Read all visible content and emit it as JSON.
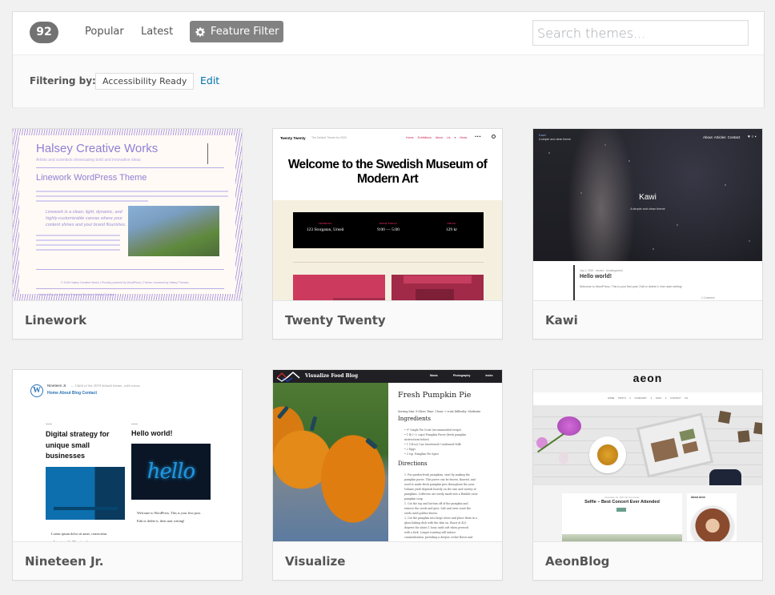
{
  "filter_bar": {
    "count": "92",
    "tabs": [
      {
        "label": "Popular"
      },
      {
        "label": "Latest"
      }
    ],
    "feature_filter": {
      "label": "Feature Filter",
      "icon": "gear-icon",
      "active": true
    },
    "search": {
      "placeholder": "Search themes...",
      "value": ""
    },
    "filtering_label": "Filtering by:",
    "active_filters": [
      "Accessibility Ready"
    ],
    "edit_label": "Edit",
    "colors": {
      "badge": "#727272",
      "feature_filter_bg": "#828282",
      "link": "#0073aa"
    }
  },
  "themes": [
    {
      "name": "Linework",
      "preview": {
        "site_title": "Halsey Creative Works",
        "tagline": "Artists and scientists showcasing bold and innovative ideas",
        "heading": "Linework WordPress Theme",
        "quote": "Linework is a clean, light, dynamic, and highly-customizable canvas where your content shines and your brand flourishes.",
        "footer": "© 2016 Halsey Creative Works | Proudly powered by WordPress | Theme: Linework by Halsey Themes.",
        "menu": "Home   Who we Are   Our Process   Services   Artists   Contact"
      }
    },
    {
      "name": "Twenty Twenty",
      "preview": {
        "site_title": "Twenty Twenty",
        "tagline": "The Default Theme for 2020",
        "nav": "Home Exhibitions About Us ▾ News",
        "hero": "Welcome to the Swedish Museum of Modern Art",
        "info": [
          {
            "label": "ADDRESS",
            "value": "123 Storgatan, Umeå"
          },
          {
            "label": "OPEN TODAY",
            "value": "9:00 — 5:00"
          },
          {
            "label": "PRICE",
            "value": "129 kr"
          }
        ]
      }
    },
    {
      "name": "Kawi",
      "preview": {
        "site_title": "Kawi",
        "tagline": "A simple and clean theme",
        "nav": "About  Articles  Contact",
        "hero_title": "Kawi",
        "hero_tagline": "A simple and clean theme",
        "post_meta": "July 1, 2019 · vincent · Uncategorized",
        "post_title": "Hello world!",
        "post_excerpt": "Welcome to WordPress. This is your first post. Edit or delete it, then start writing!",
        "comments": "1 Comment"
      }
    },
    {
      "name": "Nineteen Jr.",
      "preview": {
        "site_title": "Nineteen Jr.",
        "tagline": "— Child of the 2019 default theme, with extras",
        "nav": "Home About Blog Contact",
        "post1_title": "Digital strategy for unique small businesses",
        "post1_excerpt": "Lorem ipsum dolor sit amet, consectetur adipiscing elit. Mauris sed",
        "post2_title": "Hello world!",
        "post2_image_text": "hello",
        "post2_excerpt": "Welcome to WordPress. This is your first post. Edit or delete it, then start writing!"
      }
    },
    {
      "name": "Visualize",
      "preview": {
        "site_title": "Visualize Food Blog",
        "nav": "Music Photography Index",
        "post_title": "Fresh Pumpkin Pie",
        "meta": "Serving Size: 8 Slices   Time: 1 hour + crust   Difficulty: Moderate",
        "ingredients_heading": "Ingredients",
        "ingredients": [
          "• 9\" Single Pie Crust (recommended recipe)",
          "• 1 lb (~2 cups) Pumpkin Puree (fresh pumpkin",
          "  instructions below)",
          "• 1 (14-oz) Can Sweetened Condensed Milk",
          "• 2 Eggs",
          "• 3 tsp. Pumpkin Pie Spice"
        ],
        "directions_heading": "Directions",
        "directions": [
          "1. For garden-fresh pumpkins, start by making the",
          "   pumpkin puree. This puree can be frozen, thawed, and",
          "   used to make fresh pumpkin pies throughout the year.",
          "   Volume yield depends heavily on the size and variety of",
          "   pumpkins. Leftovers are easily made into a flexible cutie",
          "   pumpkin soup.",
          "   1. Cut the top and bottom off of the pumpkin and",
          "      remove the seeds and guts. Salt and oven roast the",
          "      seeds until golden-brown.",
          "   2. Cut the pumpkin into large slices and place them in a",
          "      glass baking dish with the skin on. Roast at 425",
          "      degrees for about 1 hour, until soft when pressed",
          "      with a fork. Longer roasting will induce",
          "      caramelization, providing a deeper, richer flavor and"
        ]
      }
    },
    {
      "name": "AeonBlog",
      "preview": {
        "logo": "aeon",
        "nav": "HOME  POSTS ▾  CATEGORY ▾  TAGS ▾  CONTACT US",
        "post_date": "November 21, 2017   No Comments",
        "post_title": "Selfie – Best Concert Ever Attended",
        "sidebar_heading": "About Aeon"
      }
    }
  ]
}
